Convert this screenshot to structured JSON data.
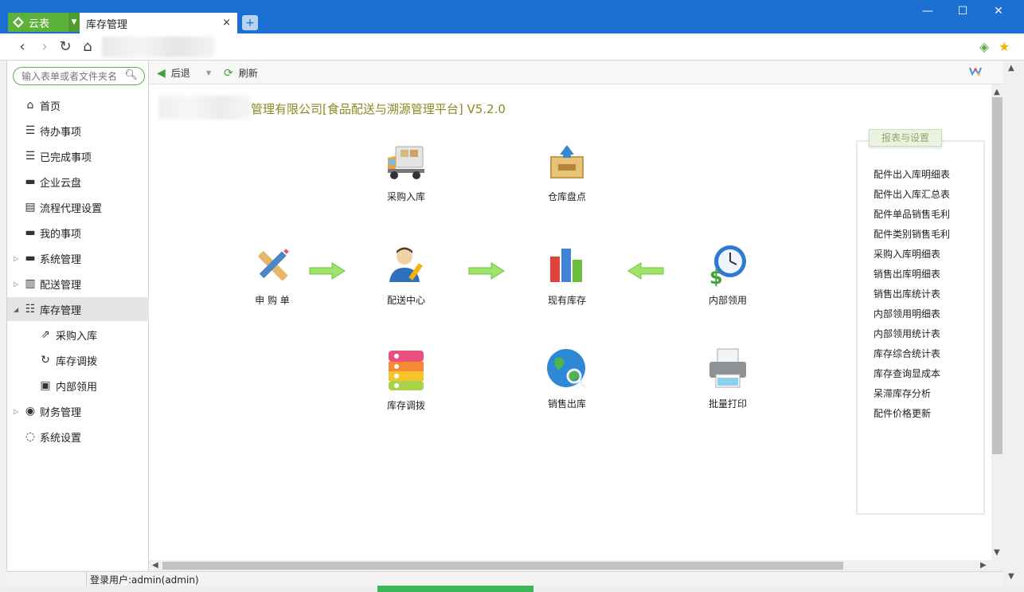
{
  "window": {
    "app_name": "云表",
    "tab_title": "库存管理",
    "tab_close": "×",
    "new_tab": "+",
    "minimize": "—",
    "maximize": "☐",
    "close": "✕"
  },
  "search": {
    "placeholder": "输入表单或者文件夹名"
  },
  "sidebar": {
    "items": [
      {
        "label": "首页"
      },
      {
        "label": "待办事项"
      },
      {
        "label": "已完成事项"
      },
      {
        "label": "企业云盘"
      },
      {
        "label": "流程代理设置"
      },
      {
        "label": "我的事项"
      },
      {
        "label": "系统管理"
      },
      {
        "label": "配送管理"
      },
      {
        "label": "库存管理"
      },
      {
        "label": "采购入库"
      },
      {
        "label": "库存调拨"
      },
      {
        "label": "内部领用"
      },
      {
        "label": "财务管理"
      },
      {
        "label": "系统设置"
      }
    ]
  },
  "toolbar": {
    "back_label": "后退",
    "refresh_label": "刷新"
  },
  "content": {
    "title": "管理有限公司[食品配送与溯源管理平台] V5.2.0"
  },
  "flow": {
    "purchase_in": "采购入库",
    "inventory_check": "仓库盘点",
    "requisition": "申 购 单",
    "distribution_center": "配送中心",
    "current_stock": "现有库存",
    "internal_use": "内部领用",
    "stock_transfer": "库存调拨",
    "sales_out": "销售出库",
    "batch_print": "批量打印"
  },
  "reports": {
    "title": "报表与设置",
    "links": [
      "配件出入库明细表",
      "配件出入库汇总表",
      "配件单品销售毛利",
      "配件类别销售毛利",
      "采购入库明细表",
      "销售出库明细表",
      "销售出库统计表",
      "内部领用明细表",
      "内部领用统计表",
      "库存综合统计表",
      "库存查询显成本",
      "呆滞库存分析",
      "配件价格更新"
    ]
  },
  "status": {
    "login_user": "登录用户:admin(admin)"
  },
  "colors": {
    "titlebar": "#1a6fd1",
    "brand": "#5bb13a",
    "title_text": "#8c8a22"
  }
}
